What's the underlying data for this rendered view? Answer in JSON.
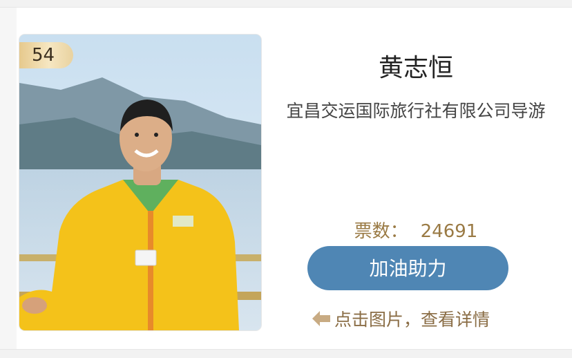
{
  "entry": {
    "rank": "54",
    "name": "黄志恒",
    "organization": "宜昌交运国际旅行社有限公司导游",
    "votes_label": "票数：",
    "votes_count": "24691",
    "boost_button": "加油助力",
    "hint_text": "点击图片，查看详情",
    "photo_icon": "person-photo"
  },
  "colors": {
    "button": "#4f86b4",
    "accent_text": "#9a7a44",
    "badge_gold": "#e6c98d"
  }
}
